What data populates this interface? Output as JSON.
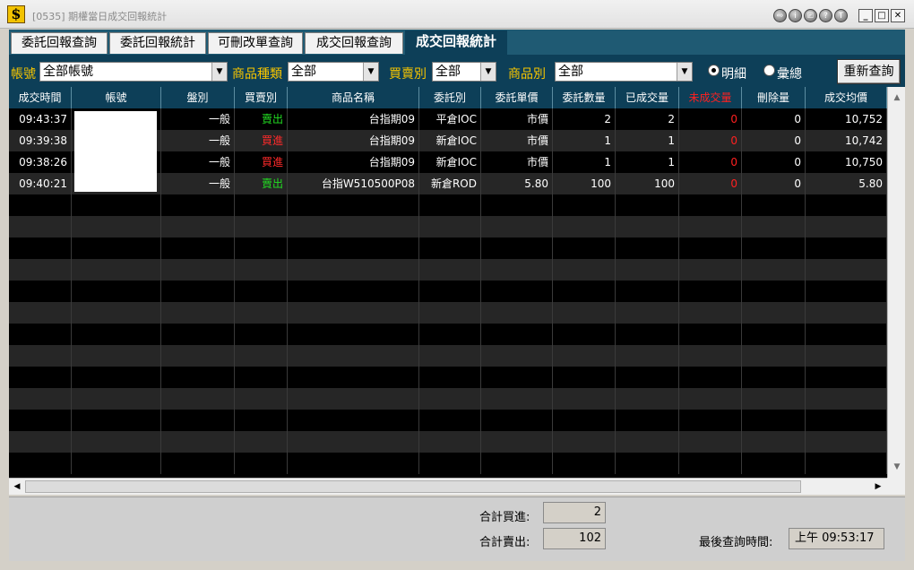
{
  "window": {
    "title": "[0535] 期權當日成交回報統計",
    "round_buttons": [
      "⇨",
      "i",
      "⎚",
      "?",
      "T"
    ],
    "min": "_",
    "max": "□",
    "close": "✕"
  },
  "tabs": [
    {
      "label": "委託回報查詢",
      "active": false
    },
    {
      "label": "委託回報統計",
      "active": false
    },
    {
      "label": "可刪改單查詢",
      "active": false
    },
    {
      "label": "成交回報查詢",
      "active": false
    },
    {
      "label": "成交回報統計",
      "active": true
    }
  ],
  "filters": {
    "account_label": "帳號",
    "account_value": "全部帳號",
    "product_type_label": "商品種類",
    "product_type_value": "全部",
    "side_label": "買賣別",
    "side_value": "全部",
    "product_label": "商品別",
    "product_value": "全部",
    "radio_detail": "明細",
    "radio_summary": "彙總",
    "radio_selected": "明細",
    "requery_button": "重新查詢"
  },
  "table": {
    "columns": [
      "成交時間",
      "帳號",
      "盤別",
      "買賣別",
      "商品名稱",
      "委託別",
      "委託單價",
      "委託數量",
      "已成交量",
      "未成交量",
      "刪除量",
      "成交均價"
    ],
    "rows": [
      {
        "time": "09:43:37",
        "account": "",
        "session": "一般",
        "side": "賣出",
        "product": "台指期09",
        "order_type": "平倉IOC",
        "price": "市價",
        "qty": "2",
        "filled": "2",
        "unfilled": "0",
        "deleted": "0",
        "avg_price": "10,752"
      },
      {
        "time": "09:39:38",
        "account": "",
        "session": "一般",
        "side": "買進",
        "product": "台指期09",
        "order_type": "新倉IOC",
        "price": "市價",
        "qty": "1",
        "filled": "1",
        "unfilled": "0",
        "deleted": "0",
        "avg_price": "10,742"
      },
      {
        "time": "09:38:26",
        "account": "",
        "session": "一般",
        "side": "買進",
        "product": "台指期09",
        "order_type": "新倉IOC",
        "price": "市價",
        "qty": "1",
        "filled": "1",
        "unfilled": "0",
        "deleted": "0",
        "avg_price": "10,750"
      },
      {
        "time": "09:40:21",
        "account": "",
        "session": "一般",
        "side": "賣出",
        "product": "台指W510500P08",
        "order_type": "新倉ROD",
        "price": "5.80",
        "qty": "100",
        "filled": "100",
        "unfilled": "0",
        "deleted": "0",
        "avg_price": "5.80"
      }
    ]
  },
  "colors": {
    "buy": "#ff2a2a",
    "sell": "#22dd22",
    "unfilled": "#ff2020"
  },
  "footer": {
    "total_buy_label": "合計買進:",
    "total_buy_value": "2",
    "total_sell_label": "合計賣出:",
    "total_sell_value": "102",
    "last_query_label": "最後查詢時間:",
    "last_query_value": "上午  09:53:17"
  }
}
